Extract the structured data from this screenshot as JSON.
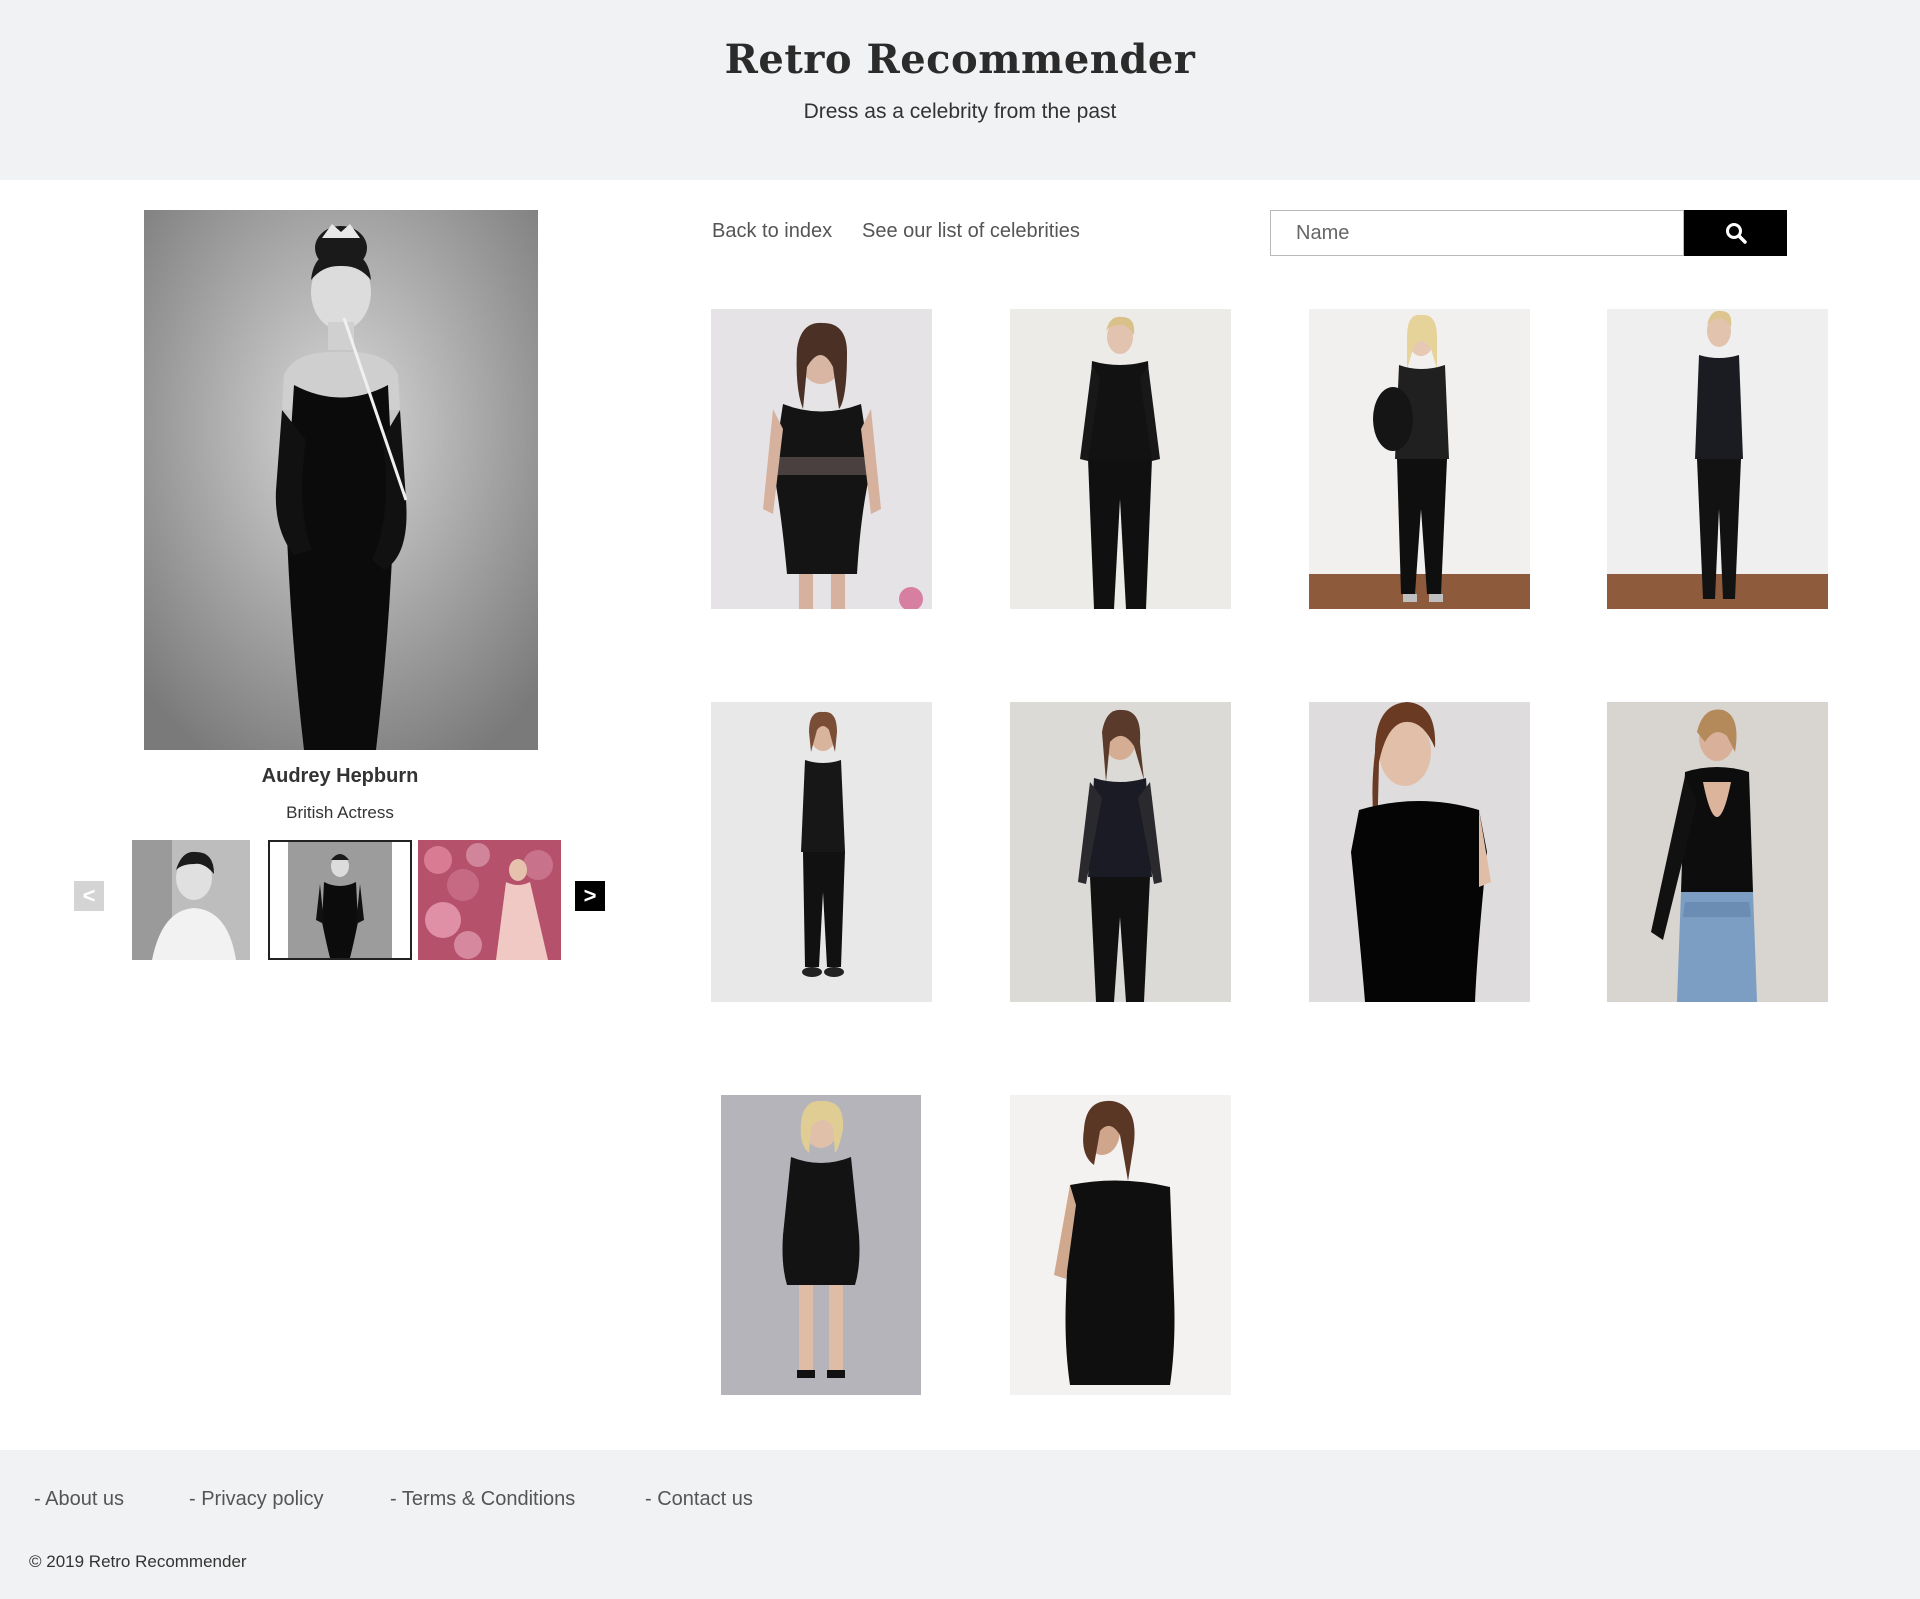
{
  "header": {
    "title": "Retro Recommender",
    "subtitle": "Dress as a celebrity from the past"
  },
  "nav": {
    "back": "Back to index",
    "celebrities": "See our list of celebrities"
  },
  "search": {
    "placeholder": "Name",
    "icon": "search-icon"
  },
  "celebrity": {
    "name": "Audrey Hepburn",
    "role": "British Actress"
  },
  "carousel": {
    "prev": "<",
    "next": ">",
    "selected_index": 1
  },
  "footer": {
    "links": [
      "- About us",
      "- Privacy policy",
      "- Terms & Conditions",
      "- Contact us"
    ],
    "copyright": "© 2019 Retro Recommender"
  },
  "colors": {
    "header_bg": "#f1f2f3",
    "search_button": "#000000",
    "carousel_prev_disabled": "#d4d4d4",
    "carousel_next": "#000000"
  }
}
